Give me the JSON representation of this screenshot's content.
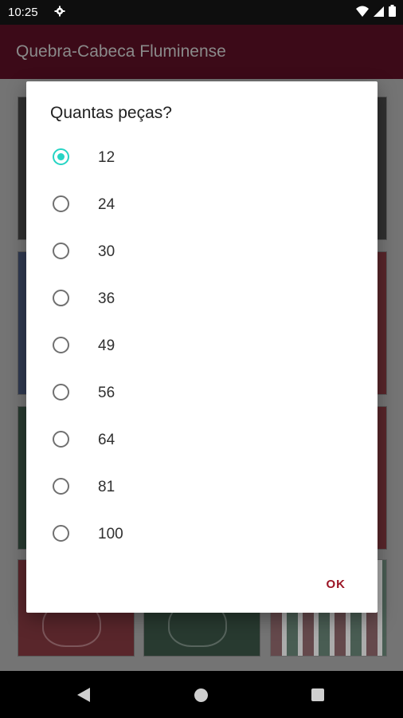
{
  "status_bar": {
    "time": "10:25",
    "icons": [
      "gear-icon",
      "wifi-icon",
      "signal-icon",
      "battery-icon"
    ]
  },
  "app_bar": {
    "title": "Quebra-Cabeca Fluminense",
    "color": "#3c0a18"
  },
  "dialog": {
    "title": "Quantas peças?",
    "options": [
      {
        "label": "12",
        "selected": true
      },
      {
        "label": "24",
        "selected": false
      },
      {
        "label": "30",
        "selected": false
      },
      {
        "label": "36",
        "selected": false
      },
      {
        "label": "49",
        "selected": false
      },
      {
        "label": "56",
        "selected": false
      },
      {
        "label": "64",
        "selected": false
      },
      {
        "label": "81",
        "selected": false
      },
      {
        "label": "100",
        "selected": false
      }
    ],
    "ok_label": "OK",
    "accent_color": "#26d4c4",
    "button_color": "#9b1424"
  },
  "nav_bar": {
    "icons": [
      "back-icon",
      "home-icon",
      "recents-icon"
    ]
  }
}
